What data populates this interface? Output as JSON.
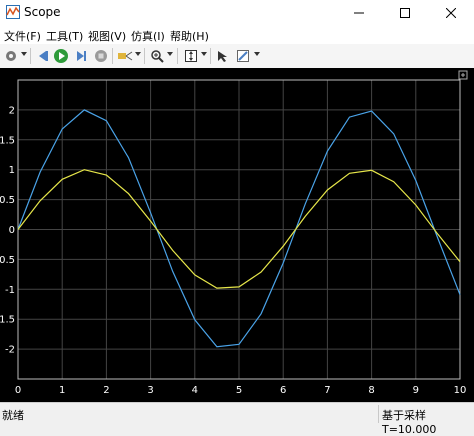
{
  "window": {
    "title": "Scope"
  },
  "menu": [
    "文件(F)",
    "工具(T)",
    "视图(V)",
    "仿真(I)",
    "帮助(H)"
  ],
  "toolbar": {
    "icons": [
      "gear-icon",
      "back-icon",
      "run-icon",
      "step-icon",
      "stop-icon",
      "highlight-icon",
      "zoom-icon",
      "scale-axes-icon",
      "cursor-measure-icon",
      "style-icon"
    ]
  },
  "status": {
    "left": "就绪",
    "right": "基于采样  T=10.000"
  },
  "colors": {
    "plot_bg": "#000000",
    "axes": "#ffffff",
    "grid": "#444444",
    "series1": "#4aa3e8",
    "series2": "#e6e64a"
  },
  "chart_data": {
    "type": "line",
    "title": "",
    "xlabel": "",
    "ylabel": "",
    "xlim": [
      0,
      10
    ],
    "ylim": [
      -2.5,
      2.5
    ],
    "x_ticks": [
      "0",
      "1",
      "2",
      "3",
      "4",
      "5",
      "6",
      "7",
      "8",
      "9",
      "10"
    ],
    "y_ticks": [
      "2",
      "1.5",
      "1",
      "0.5",
      "0",
      "-0.5",
      "-1",
      "-1.5",
      "-2"
    ],
    "grid": true,
    "series": [
      {
        "color": "#4aa3e8",
        "x": [
          0,
          0.5,
          1,
          1.5,
          2,
          2.5,
          3,
          3.5,
          4,
          4.5,
          5,
          5.5,
          6,
          6.5,
          7,
          7.5,
          8,
          8.5,
          9,
          9.5,
          10
        ],
        "y": [
          0,
          0.96,
          1.68,
          2.0,
          1.82,
          1.2,
          0.28,
          -0.7,
          -1.51,
          -1.96,
          -1.92,
          -1.41,
          -0.56,
          0.43,
          1.31,
          1.88,
          1.98,
          1.6,
          0.82,
          -0.15,
          -1.09
        ]
      },
      {
        "color": "#e6e64a",
        "x": [
          0,
          0.5,
          1,
          1.5,
          2,
          2.5,
          3,
          3.5,
          4,
          4.5,
          5,
          5.5,
          6,
          6.5,
          7,
          7.5,
          8,
          8.5,
          9,
          9.5,
          10
        ],
        "y": [
          0,
          0.48,
          0.84,
          1.0,
          0.91,
          0.6,
          0.14,
          -0.35,
          -0.76,
          -0.98,
          -0.96,
          -0.71,
          -0.28,
          0.22,
          0.66,
          0.94,
          0.99,
          0.8,
          0.41,
          -0.08,
          -0.54
        ]
      }
    ]
  }
}
